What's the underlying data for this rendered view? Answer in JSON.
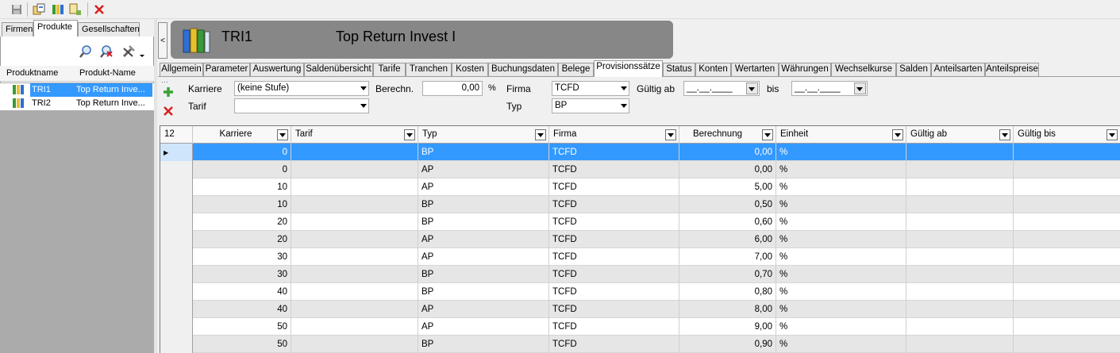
{
  "toolbar": {
    "icons": [
      "save-icon",
      "copy-icon",
      "product-icon",
      "export-icon",
      "delete-icon"
    ]
  },
  "left": {
    "tabs": [
      "Firmen",
      "Produkte",
      "Gesellschaften"
    ],
    "active_tab": "Produkte",
    "columns": [
      "Produktname",
      "Produkt-Name"
    ],
    "rows": [
      {
        "name": "TRI1",
        "pname": "Top Return Inve..."
      },
      {
        "name": "TRI2",
        "pname": "Top Return Inve..."
      }
    ]
  },
  "banner": {
    "collapse": "<",
    "code": "TRI1",
    "name": "Top Return Invest I"
  },
  "tabs": [
    "Allgemein",
    "Parameter",
    "Auswertung",
    "Saldenübersicht",
    "Tarife",
    "Tranchen",
    "Kosten",
    "Buchungsdaten",
    "Belege",
    "Provisionssätze",
    "Status",
    "Konten",
    "Wertarten",
    "Währungen",
    "Wechselkurse",
    "Salden",
    "Anteilsarten",
    "Anteilspreise"
  ],
  "active_tab": "Provisionssätze",
  "filter": {
    "karriere_label": "Karriere",
    "karriere_value": "(keine Stufe)",
    "tarif_label": "Tarif",
    "tarif_value": "",
    "berechn_label": "Berechn.",
    "berechn_value": "0,00",
    "berechn_unit": "%",
    "firma_label": "Firma",
    "firma_value": "TCFD",
    "typ_label": "Typ",
    "typ_value": "BP",
    "gueltig_ab_label": "Gültig ab",
    "gueltig_ab_value": "__.__.____",
    "bis_label": "bis",
    "bis_value": "__.__.____"
  },
  "grid": {
    "count": "12",
    "columns": [
      "Karriere",
      "Tarif",
      "Typ",
      "Firma",
      "Berechnung",
      "Einheit",
      "Gültig ab",
      "Gültig bis"
    ],
    "rows": [
      {
        "karriere": "0",
        "tarif": "",
        "typ": "BP",
        "firma": "TCFD",
        "berechnung": "0,00",
        "einheit": "%",
        "ab": "",
        "bis": ""
      },
      {
        "karriere": "0",
        "tarif": "",
        "typ": "AP",
        "firma": "TCFD",
        "berechnung": "0,00",
        "einheit": "%",
        "ab": "",
        "bis": ""
      },
      {
        "karriere": "10",
        "tarif": "",
        "typ": "AP",
        "firma": "TCFD",
        "berechnung": "5,00",
        "einheit": "%",
        "ab": "",
        "bis": ""
      },
      {
        "karriere": "10",
        "tarif": "",
        "typ": "BP",
        "firma": "TCFD",
        "berechnung": "0,50",
        "einheit": "%",
        "ab": "",
        "bis": ""
      },
      {
        "karriere": "20",
        "tarif": "",
        "typ": "BP",
        "firma": "TCFD",
        "berechnung": "0,60",
        "einheit": "%",
        "ab": "",
        "bis": ""
      },
      {
        "karriere": "20",
        "tarif": "",
        "typ": "AP",
        "firma": "TCFD",
        "berechnung": "6,00",
        "einheit": "%",
        "ab": "",
        "bis": ""
      },
      {
        "karriere": "30",
        "tarif": "",
        "typ": "AP",
        "firma": "TCFD",
        "berechnung": "7,00",
        "einheit": "%",
        "ab": "",
        "bis": ""
      },
      {
        "karriere": "30",
        "tarif": "",
        "typ": "BP",
        "firma": "TCFD",
        "berechnung": "0,70",
        "einheit": "%",
        "ab": "",
        "bis": ""
      },
      {
        "karriere": "40",
        "tarif": "",
        "typ": "BP",
        "firma": "TCFD",
        "berechnung": "0,80",
        "einheit": "%",
        "ab": "",
        "bis": ""
      },
      {
        "karriere": "40",
        "tarif": "",
        "typ": "AP",
        "firma": "TCFD",
        "berechnung": "8,00",
        "einheit": "%",
        "ab": "",
        "bis": ""
      },
      {
        "karriere": "50",
        "tarif": "",
        "typ": "AP",
        "firma": "TCFD",
        "berechnung": "9,00",
        "einheit": "%",
        "ab": "",
        "bis": ""
      },
      {
        "karriere": "50",
        "tarif": "",
        "typ": "BP",
        "firma": "TCFD",
        "berechnung": "0,90",
        "einheit": "%",
        "ab": "",
        "bis": ""
      }
    ]
  },
  "colors": {
    "selection": "#3399ff",
    "banner": "#878787"
  }
}
